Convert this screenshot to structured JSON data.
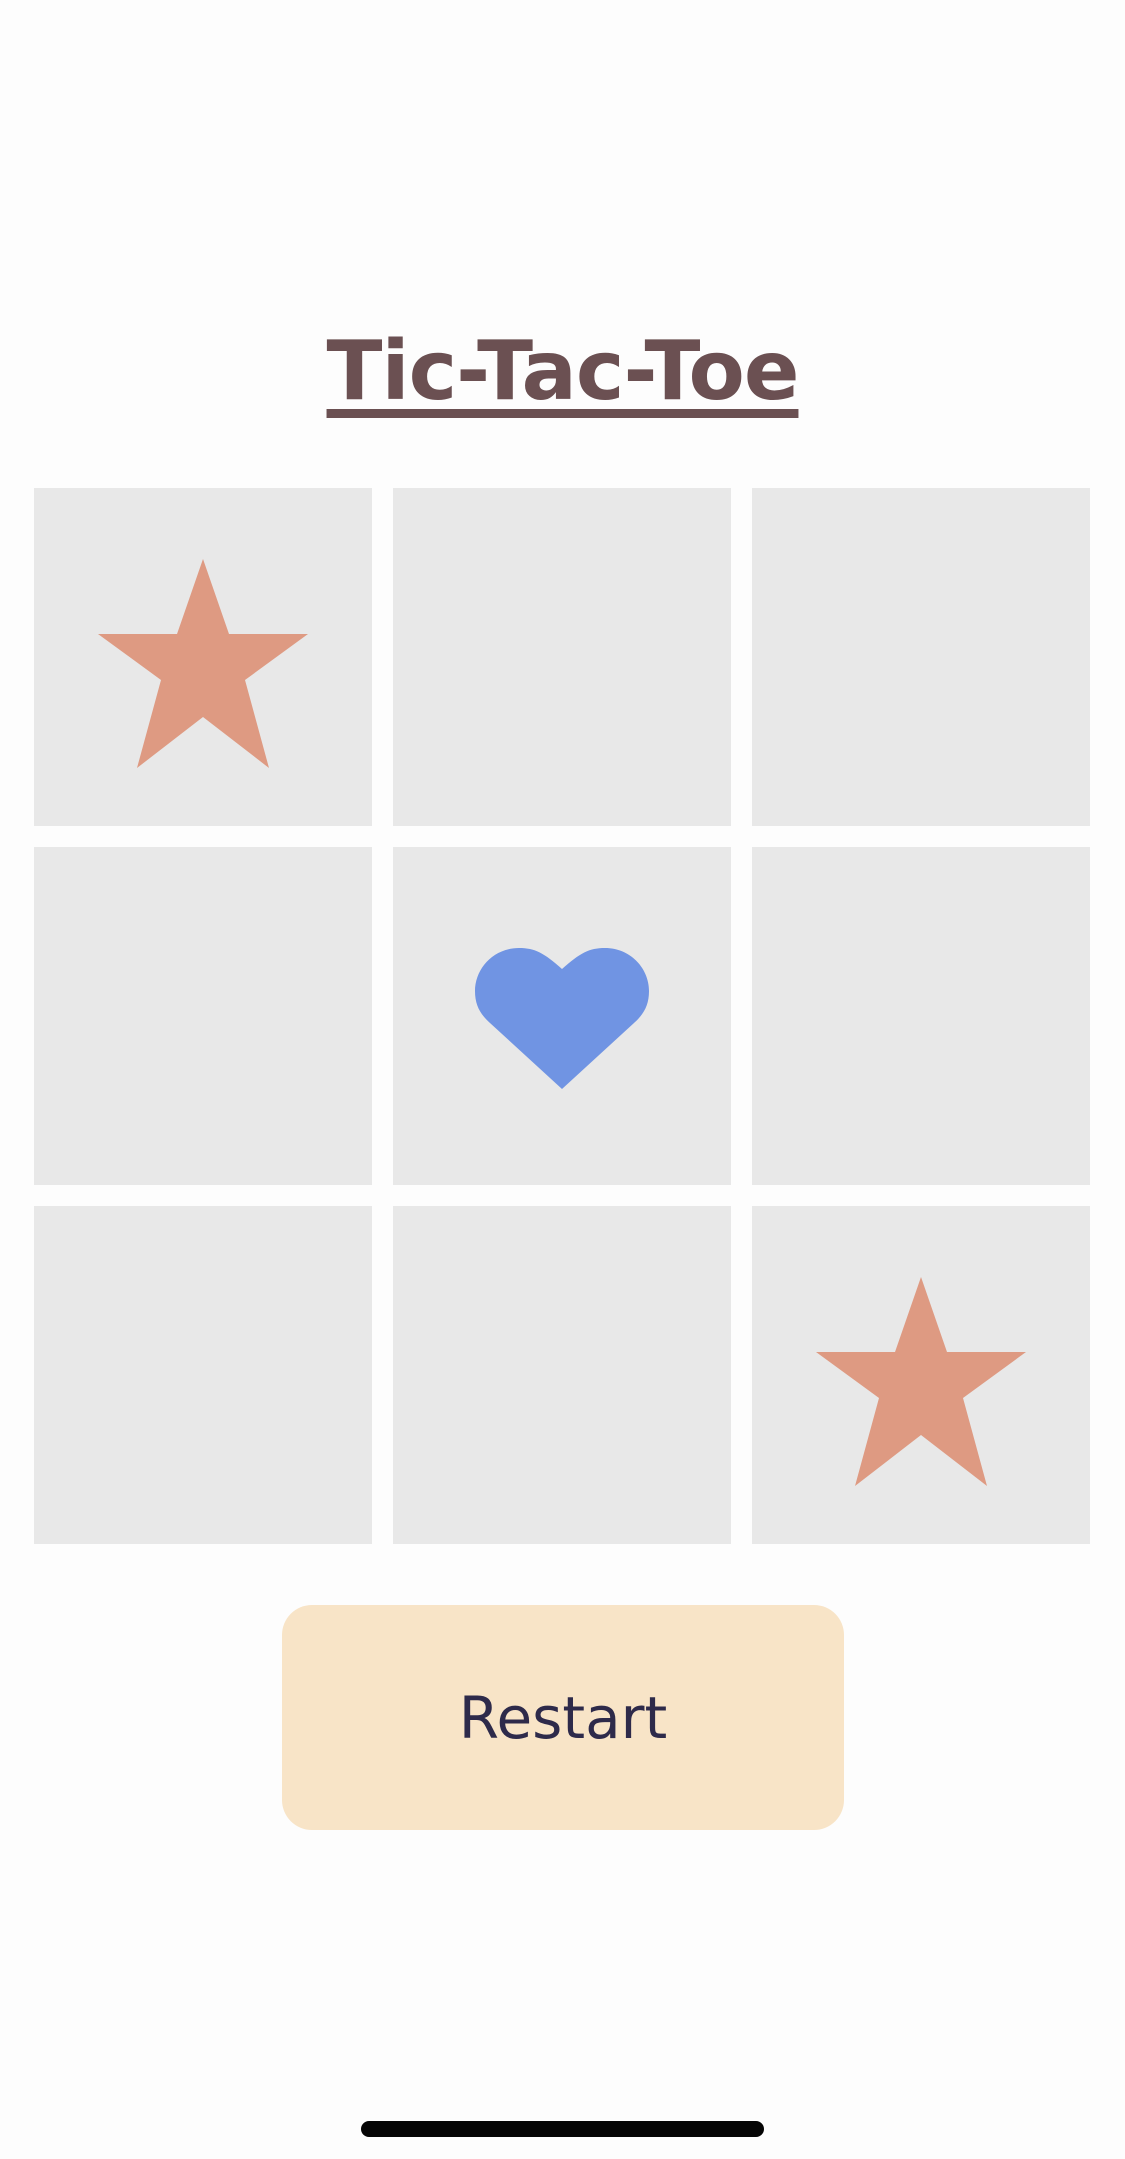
{
  "title": "Tic-Tac-Toe",
  "board": [
    [
      "star",
      "",
      ""
    ],
    [
      "",
      "heart",
      ""
    ],
    [
      "",
      "",
      "star"
    ]
  ],
  "icons": {
    "star": "star-icon",
    "heart": "heart-icon"
  },
  "colors": {
    "star": "#de9a82",
    "heart": "#7094e3",
    "cell": "#e8e8e8",
    "title": "#6b5052",
    "restart_bg": "#f8e4c7",
    "restart_text": "#2e2a4a"
  },
  "restart_label": "Restart"
}
